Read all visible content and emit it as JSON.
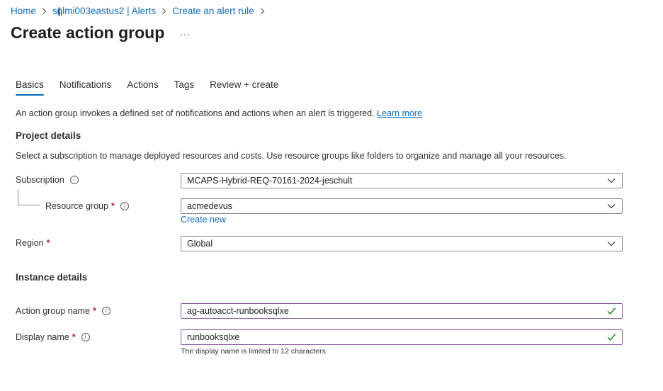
{
  "breadcrumb": {
    "items": [
      "Home",
      "sqlmi003eastus2 | Alerts",
      "Create an alert rule"
    ]
  },
  "page": {
    "title": "Create action group",
    "more_label": "..."
  },
  "tabs": [
    {
      "label": "Basics",
      "active": true
    },
    {
      "label": "Notifications",
      "active": false
    },
    {
      "label": "Actions",
      "active": false
    },
    {
      "label": "Tags",
      "active": false
    },
    {
      "label": "Review + create",
      "active": false
    }
  ],
  "intro": {
    "text": "An action group invokes a defined set of notifications and actions when an alert is triggered.",
    "link": "Learn more"
  },
  "project_details": {
    "heading": "Project details",
    "description": "Select a subscription to manage deployed resources and costs. Use resource groups like folders to organize and manage all your resources.",
    "subscription": {
      "label": "Subscription",
      "value": "MCAPS-Hybrid-REQ-70161-2024-jeschult"
    },
    "resource_group": {
      "label": "Resource group",
      "required": "*",
      "value": "acmedevus",
      "create_new": "Create new"
    },
    "region": {
      "label": "Region",
      "required": "*",
      "value": "Global"
    }
  },
  "instance_details": {
    "heading": "Instance details",
    "action_group_name": {
      "label": "Action group name",
      "required": "*",
      "value": "ag-autoacct-runbooksqlxe"
    },
    "display_name": {
      "label": "Display name",
      "required": "*",
      "value": "runbooksqlxe",
      "hint": "The display name is limited to 12 characters"
    }
  },
  "colors": {
    "accent": "#0f6cbd",
    "valid_border": "#8b5aa5",
    "valid_check": "#107c10",
    "required": "#a4262c"
  },
  "icons": {
    "info": "info-icon",
    "dropdown": "chevron-down-icon",
    "valid": "checkmark-icon",
    "separator": "chevron-right-icon"
  }
}
